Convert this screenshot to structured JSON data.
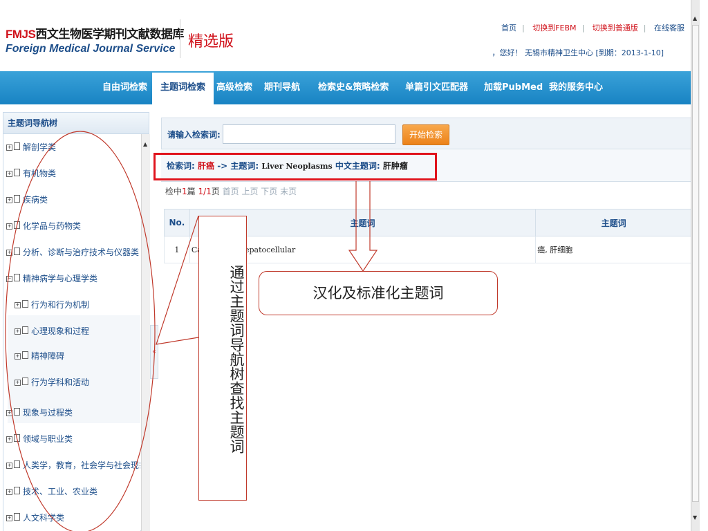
{
  "header": {
    "logo_brand": "FMJS",
    "logo_cn": "西文生物医学期刊文献数据库",
    "logo_en": "Foreign Medical Journal Service",
    "edition": "精选版",
    "links": {
      "home": "首页",
      "switch_febm": "切换到FEBM",
      "switch_normal": "切换到普通版",
      "online_service": "在线客服"
    },
    "user_line": "，您好！ 无锡市精神卫生中心 [到期：2013-1-10]"
  },
  "nav": {
    "items": [
      "自由词检索",
      "主题词检索",
      "高级检索",
      "期刊导航",
      "检索史&策略检索",
      "单篇引文匹配器",
      "加载PubMed",
      "我的服务中心"
    ],
    "active": "主题词检索"
  },
  "sidebar": {
    "title": "主题词导航树",
    "items": [
      {
        "label": "解剖学类",
        "expanded": false
      },
      {
        "label": "有机物类",
        "expanded": false
      },
      {
        "label": "疾病类",
        "expanded": false
      },
      {
        "label": "化学品与药物类",
        "expanded": false
      },
      {
        "label": "分析、诊断与治疗技术与仪器类",
        "expanded": false
      },
      {
        "label": "精神病学与心理学类",
        "expanded": true
      },
      {
        "label": "行为和行为机制",
        "child": true
      },
      {
        "label": "心理现象和过程",
        "child": true
      },
      {
        "label": "精神障碍",
        "child": true
      },
      {
        "label": "行为学科和活动",
        "child": true
      },
      {
        "label": "现象与过程类",
        "expanded": false
      },
      {
        "label": "领域与职业类",
        "expanded": false
      },
      {
        "label": "人类学，教育，社会学与社会现象类",
        "expanded": false
      },
      {
        "label": "技术、工业、农业类",
        "expanded": false
      },
      {
        "label": "人文科学类",
        "expanded": false
      }
    ],
    "collapse_glyph": "«"
  },
  "search": {
    "label": "请输入检索词:",
    "value": "",
    "button": "开始检索"
  },
  "query": {
    "prefix": "检索词:",
    "term": "肝癌",
    "arrow": " -> 主题词: ",
    "subject_en": "Liver Neoplasms",
    "cn_label": "  中文主题词: ",
    "subject_cn": "肝肿瘤"
  },
  "pager": {
    "prefix": "检中",
    "count": "1",
    "mid1": "篇 ",
    "page": "1/1",
    "mid2": "页 ",
    "links": "首页 上页 下页 末页"
  },
  "results": {
    "columns": [
      "No.",
      "主题词",
      "主题词"
    ],
    "rows": [
      {
        "no": "1",
        "en": "Carcinoma, Hepatocellular",
        "cn": "癌, 肝细胞"
      }
    ]
  },
  "annotations": {
    "vertical_note": "通过主题词导航树查找主题词",
    "horizontal_note": "汉化及标准化主题词"
  }
}
